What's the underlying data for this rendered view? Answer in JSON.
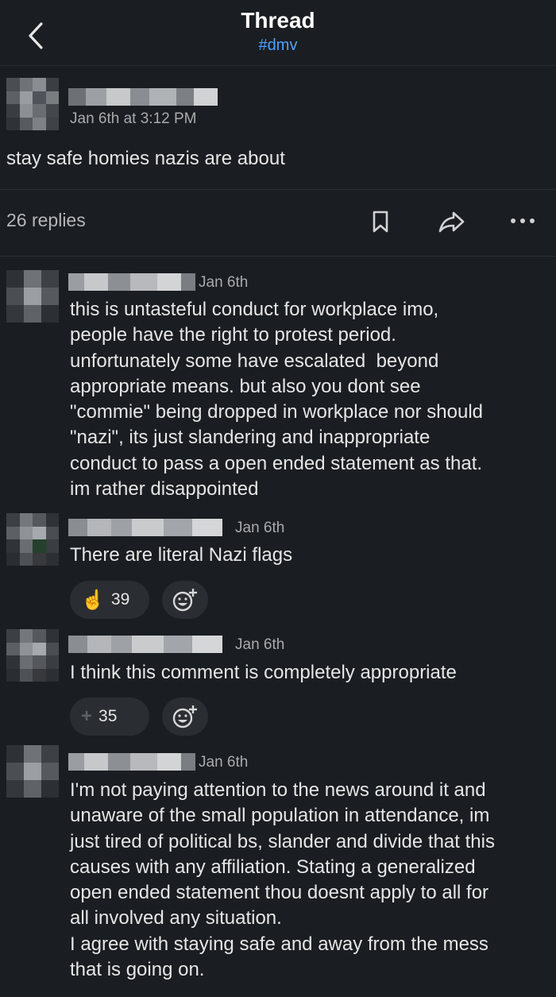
{
  "header": {
    "title": "Thread",
    "channel": "#dmv",
    "back_icon": "chevron-left-icon"
  },
  "parent": {
    "timestamp": "Jan 6th at 3:12 PM",
    "text": "stay safe homies nazis are about",
    "replies": "26 replies",
    "actions": [
      "bookmark-icon",
      "share-icon",
      "more-icon"
    ]
  },
  "replies": [
    {
      "timestamp": "Jan 6th",
      "text": "this is untasteful conduct for workplace imo,\npeople have the right to protest period.\nunfortunately some have escalated  beyond\nappropriate means. but also you dont see\n\"commie\" being dropped in workplace nor should\n\"nazi\", its just slandering and inappropriate\nconduct to pass a open ended statement as that.\nim rather disappointed"
    },
    {
      "timestamp": "Jan 6th",
      "text": "There are literal Nazi flags",
      "reaction": {
        "emoji": "☝️",
        "count": "39"
      }
    },
    {
      "timestamp": "Jan 6th",
      "text": "I think this comment is completely appropriate",
      "reaction": {
        "emoji": "+",
        "count": "35"
      }
    },
    {
      "timestamp": "Jan 6th",
      "text": "I'm not paying attention to the news around it and\nunaware of the small population in attendance, im\njust tired of political bs, slander and divide that this\ncauses with any affiliation. Stating a generalized\nopen ended statement thou doesnt apply to all for\nall involved any situation.\nI agree with staying safe and away from the mess\nthat is going on."
    }
  ],
  "colors": {
    "background": "#1a1d21",
    "accent": "#4ea1ff",
    "reaction_bg": "#2a2d31",
    "reaction_emoji": "#f2b824"
  }
}
